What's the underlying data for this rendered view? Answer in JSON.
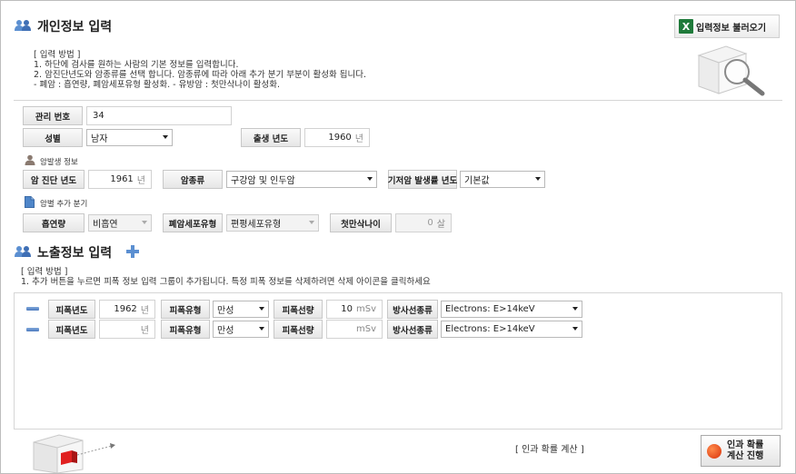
{
  "personal": {
    "title": "개인정보 입력",
    "excel_button_label": "입력정보 불러오기",
    "instructions_header": "[ 입력 방법 ]",
    "instructions": [
      "1. 하단에 검사를 원하는 사람의 기본 정보를 입력합니다.",
      "2. 암진단년도와 암종류를 선택 합니다.  암종류에 따라 아래 추가 분기 부분이 활성화 됩니다.",
      " - 폐암 : 흡연량, 폐암세포유형 활성화.  - 유방암 : 첫만삭나이 활성화."
    ],
    "management_no_label": "관리 번호",
    "management_no_value": "34",
    "gender_label": "성별",
    "gender_value": "남자",
    "birth_year_label": "출생 년도",
    "birth_year_value": "1960",
    "year_unit": "년"
  },
  "cancer_info": {
    "subhead": "암발생 정보",
    "diagnosis_year_label": "암 진단 년도",
    "diagnosis_year_value": "1961",
    "cancer_type_label": "암종류",
    "cancer_type_value": "구강암 및 인두암",
    "baseline_label": "기저암 발생률 년도",
    "baseline_value": "기본값"
  },
  "cancer_extra": {
    "subhead": "암별 추가 분기",
    "smoking_label": "흡연량",
    "smoking_value": "비흡연",
    "lung_cell_label": "폐암세포유형",
    "lung_cell_value": "편평세포유형",
    "first_birth_label": "첫만삭나이",
    "first_birth_value": "0",
    "age_unit": "살"
  },
  "exposure": {
    "title": "노출정보 입력",
    "instructions_header": "[ 입력 방법 ]",
    "instruction": "1. 추가 버튼을 누르면 피폭 정보 입력 그룹이 추가됩니다. 특정 피폭 정보를 삭제하려면 삭제 아이콘을 클릭하세요",
    "year_label": "피폭년도",
    "type_label": "피폭유형",
    "dose_label": "피폭선량",
    "radiation_label": "방사선종류",
    "year_unit": "년",
    "dose_unit": "mSv",
    "rows": [
      {
        "year": "1962",
        "type": "만성",
        "dose": "10",
        "radiation": "Electrons: E>14keV"
      },
      {
        "year": "",
        "type": "만성",
        "dose": "",
        "radiation": "Electrons: E>14keV"
      }
    ]
  },
  "footer": {
    "calc_label": "[ 인과 확률 계산 ]",
    "calc_button_line1": "인과 확률",
    "calc_button_line2": "계산 진행"
  }
}
